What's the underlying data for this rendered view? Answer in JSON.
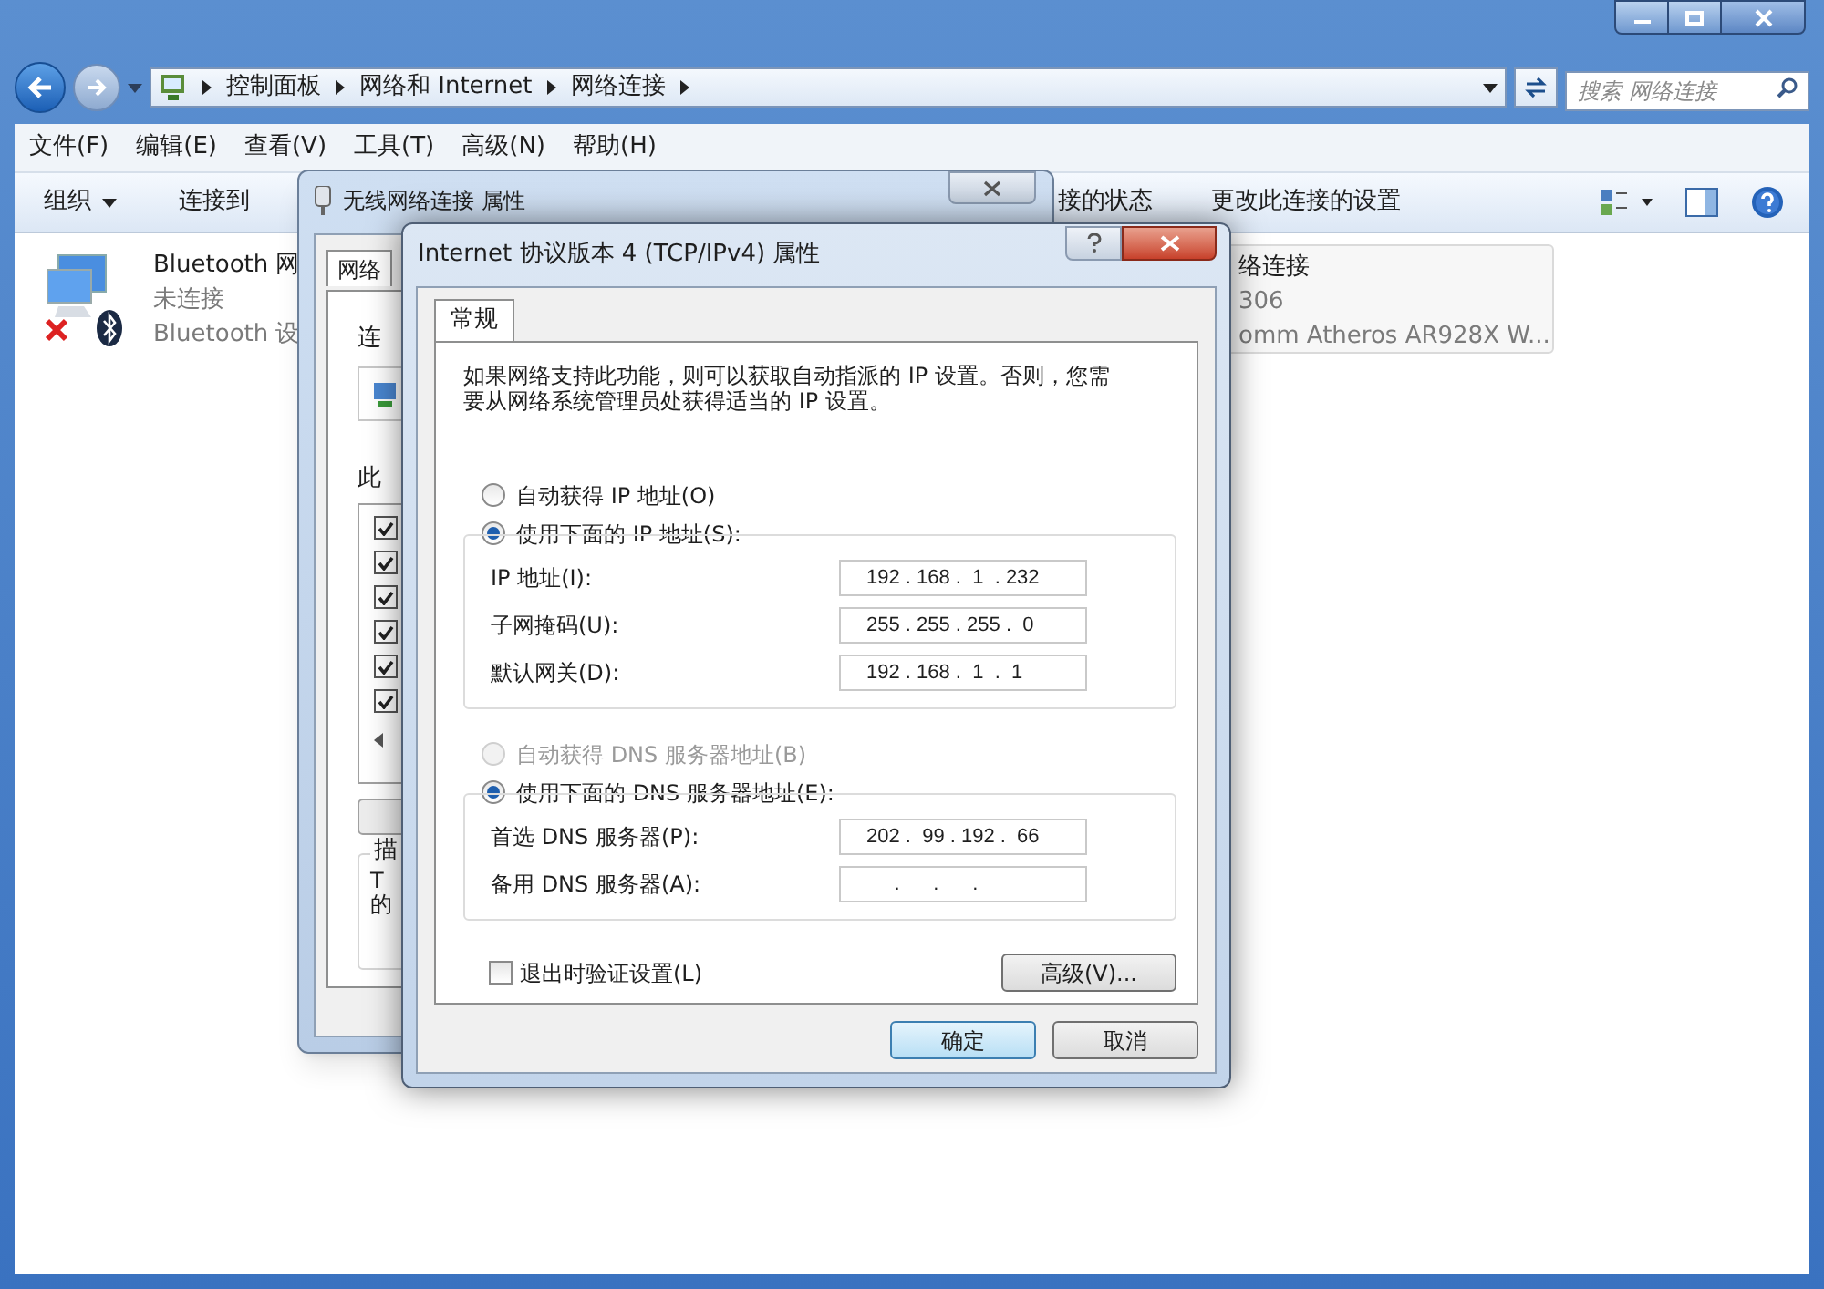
{
  "explorer": {
    "breadcrumbs": [
      "控制面板",
      "网络和 Internet",
      "网络连接"
    ],
    "search": {
      "placeholder": "搜索 网络连接"
    },
    "menu": [
      "文件(F)",
      "编辑(E)",
      "查看(V)",
      "工具(T)",
      "高级(N)",
      "帮助(H)"
    ],
    "toolbar_left": [
      {
        "label": "组织",
        "kind": "dropdown"
      },
      {
        "label": "连接到",
        "kind": "plain"
      }
    ],
    "toolbar_right": [
      "接的状态",
      "更改此连接的设置"
    ],
    "connections": [
      {
        "name": "Bluetooth 网",
        "status": "未连接",
        "device": "Bluetooth 设",
        "disconnected": true
      },
      {
        "name": "络连接",
        "status": "306",
        "device": "omm Atheros AR928X W..."
      }
    ]
  },
  "wireless_dialog": {
    "title": "无线网络连接 属性",
    "tab": "网络",
    "labels": [
      "连",
      "此"
    ],
    "items": [
      {
        "checked": true
      },
      {
        "checked": true
      },
      {
        "checked": true
      },
      {
        "checked": true
      },
      {
        "checked": true
      },
      {
        "checked": true
      }
    ],
    "description_title": "描",
    "description": [
      "T",
      "的"
    ]
  },
  "ip_dialog": {
    "title": "Internet 协议版本 4 (TCP/IPv4) 属性",
    "tabs": [
      {
        "label": "常规",
        "selected": true
      }
    ],
    "intro": "如果网络支持此功能，则可以获取自动指派的 IP 设置。否则，您需要从网络系统管理员处获得适当的 IP 设置。",
    "ip_options": [
      {
        "label": "自动获得 IP 地址(O)",
        "selected": false,
        "disabled": false
      },
      {
        "label": "使用下面的 IP 地址(S):",
        "selected": true,
        "disabled": false
      }
    ],
    "ip_fields": [
      {
        "label": "IP 地址(I):",
        "value": "192 . 168 .  1  . 232"
      },
      {
        "label": "子网掩码(U):",
        "value": "255 . 255 . 255 .  0"
      },
      {
        "label": "默认网关(D):",
        "value": "192 . 168 .  1  .  1"
      }
    ],
    "dns_options": [
      {
        "label": "自动获得 DNS 服务器地址(B)",
        "selected": false,
        "disabled": true
      },
      {
        "label": "使用下面的 DNS 服务器地址(E):",
        "selected": true,
        "disabled": false
      }
    ],
    "dns_fields": [
      {
        "label": "首选 DNS 服务器(P):",
        "value": "202 .  99 . 192 .  66"
      },
      {
        "label": "备用 DNS 服务器(A):",
        "value": "     .      .      .    "
      }
    ],
    "validate": {
      "label": "退出时验证设置(L)",
      "checked": false
    },
    "advanced_button": "高级(V)...",
    "buttons": [
      {
        "label": "确定",
        "kind": "default"
      },
      {
        "label": "取消",
        "kind": "normal"
      }
    ]
  }
}
